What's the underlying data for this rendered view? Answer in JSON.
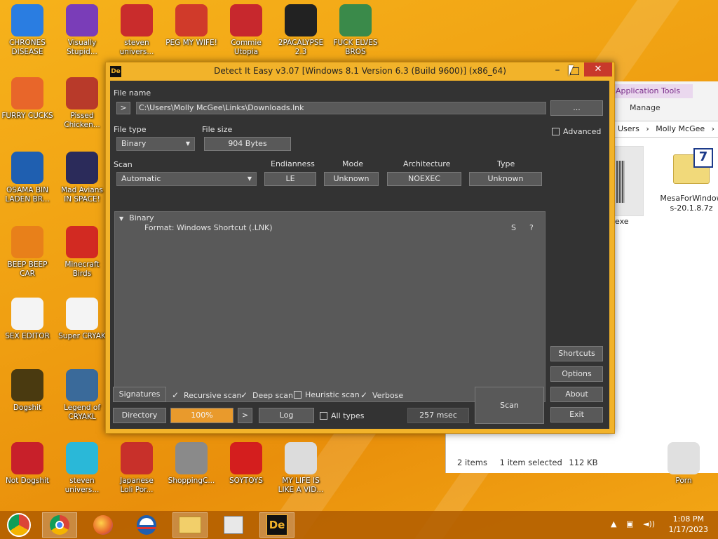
{
  "desktop_icons": [
    {
      "label": "CHRONES\nDISEASE",
      "icon": "chrome-icon",
      "color": "#2a7de1"
    },
    {
      "label": "Visually\nStupid...",
      "icon": "visual-studio-icon",
      "color": "#7a3db8"
    },
    {
      "label": "steven\nunivers...",
      "icon": "number-two-icon",
      "color": "#c92c2c"
    },
    {
      "label": "PEG MY WIFE!",
      "icon": "letter-p-icon",
      "color": "#d03a2a"
    },
    {
      "label": "Commie\nUtopia",
      "icon": "hammer-sickle-icon",
      "color": "#c7282d"
    },
    {
      "label": "2PACALYPSE\n2.3",
      "icon": "terminal-icon",
      "color": "#222222"
    },
    {
      "label": "FUCK ELVES\nBROS",
      "icon": "elf-icon",
      "color": "#3a8a4a"
    },
    {
      "label": "FURRY CUCKS",
      "icon": "firefox-icon",
      "color": "#e8662a"
    },
    {
      "label": "Pissed\nChicken...",
      "icon": "angry-bird-seasons-icon",
      "color": "#b83a2a"
    },
    {
      "label": "OSAMA BIN\nLADEN BR...",
      "icon": "obama-logo-icon",
      "color": "#1f5fb0"
    },
    {
      "label": "Mad Avians\nIN SPACE!",
      "icon": "angry-bird-space-icon",
      "color": "#2b2b5a"
    },
    {
      "label": "BEEP BEEP\nCAR",
      "icon": "vlc-cone-icon",
      "color": "#e8801a"
    },
    {
      "label": "Minecraft\nBirds",
      "icon": "red-bird-icon",
      "color": "#d22a22"
    },
    {
      "label": "SEX EDITOR",
      "icon": "hxd-icon",
      "color": "#f4f4f4"
    },
    {
      "label": "Super CRYAK",
      "icon": "pixel-dog-icon",
      "color": "#f4f4f4"
    },
    {
      "label": "Dogshit",
      "icon": "cd-disc-icon",
      "color": "#4a3a10"
    },
    {
      "label": "Legend of\nCRYAKL",
      "icon": "pixel-hero-icon",
      "color": "#3a6a9a"
    },
    {
      "label": "Not Dogshit",
      "icon": "dev-cpp-icon",
      "color": "#c8202a"
    },
    {
      "label": "steven\nunivers...",
      "icon": "diamond-icon",
      "color": "#2ab8d8"
    },
    {
      "label": "Japanese\nLoli Por...",
      "icon": "torii-gate-icon",
      "color": "#c8302a"
    },
    {
      "label": "ShoppingC...",
      "icon": "flash-icon",
      "color": "#8a8a8a"
    },
    {
      "label": "SOYTOYS",
      "icon": "letter-s-icon",
      "color": "#d41e1e"
    },
    {
      "label": "MY LIFE IS\nLIKE A VID...",
      "icon": "gamepad-icon",
      "color": "#dcdcdc"
    },
    {
      "label": "Porn",
      "icon": "file-icon",
      "color": "#e0e0e0"
    }
  ],
  "explorer": {
    "ribbon_tab": "Application Tools",
    "manage": "Manage",
    "breadcrumb": [
      "Users",
      "Molly McGee"
    ],
    "file1_name": "exe",
    "file2_name": "MesaForWindows-20.1.8.7z",
    "status": {
      "items": "2 items",
      "selected": "1 item selected",
      "size": "112 KB"
    }
  },
  "die": {
    "title": "Detect It Easy v3.07 [Windows 8.1 Version 6.3 (Build 9600)] (x86_64)",
    "app_icon_text": "De",
    "file_name_label": "File name",
    "path_button": ">",
    "file_path": "C:\\Users\\Molly McGee\\Links\\Downloads.lnk",
    "browse_button": "...",
    "file_type_label": "File type",
    "file_type_value": "Binary",
    "file_size_label": "File size",
    "file_size_value": "904 Bytes",
    "advanced_label": "Advanced",
    "scan_label": "Scan",
    "scan_value": "Automatic",
    "endianness_label": "Endianness",
    "endianness_value": "LE",
    "mode_label": "Mode",
    "mode_value": "Unknown",
    "architecture_label": "Architecture",
    "architecture_value": "NOEXEC",
    "type_label": "Type",
    "type_value": "Unknown",
    "result_root": "Binary",
    "result_item": "Format: Windows Shortcut (.LNK)",
    "result_s": "S",
    "result_q": "?",
    "side_buttons": [
      "Shortcuts",
      "Options",
      "About",
      "Exit"
    ],
    "signatures_button": "Signatures",
    "recursive_scan": "Recursive scan",
    "deep_scan": "Deep scan",
    "heuristic_scan": "Heuristic scan",
    "verbose": "Verbose",
    "directory_button": "Directory",
    "progress_text": "100%",
    "progress_fraction": 1.0,
    "next_button": ">",
    "log_button": "Log",
    "all_types": "All types",
    "elapsed": "257 msec",
    "scan_button": "Scan",
    "checks": {
      "recursive": true,
      "deep": true,
      "heuristic": false,
      "verbose": true,
      "all_types": false,
      "advanced": false
    }
  },
  "taskbar": {
    "time": "1:08 PM",
    "date": "1/17/2023"
  },
  "colors": {
    "accent": "#f2b32a",
    "client_bg": "#333333",
    "control_bg": "#595959",
    "close": "#c8392b",
    "progress": "#e99a2c"
  }
}
